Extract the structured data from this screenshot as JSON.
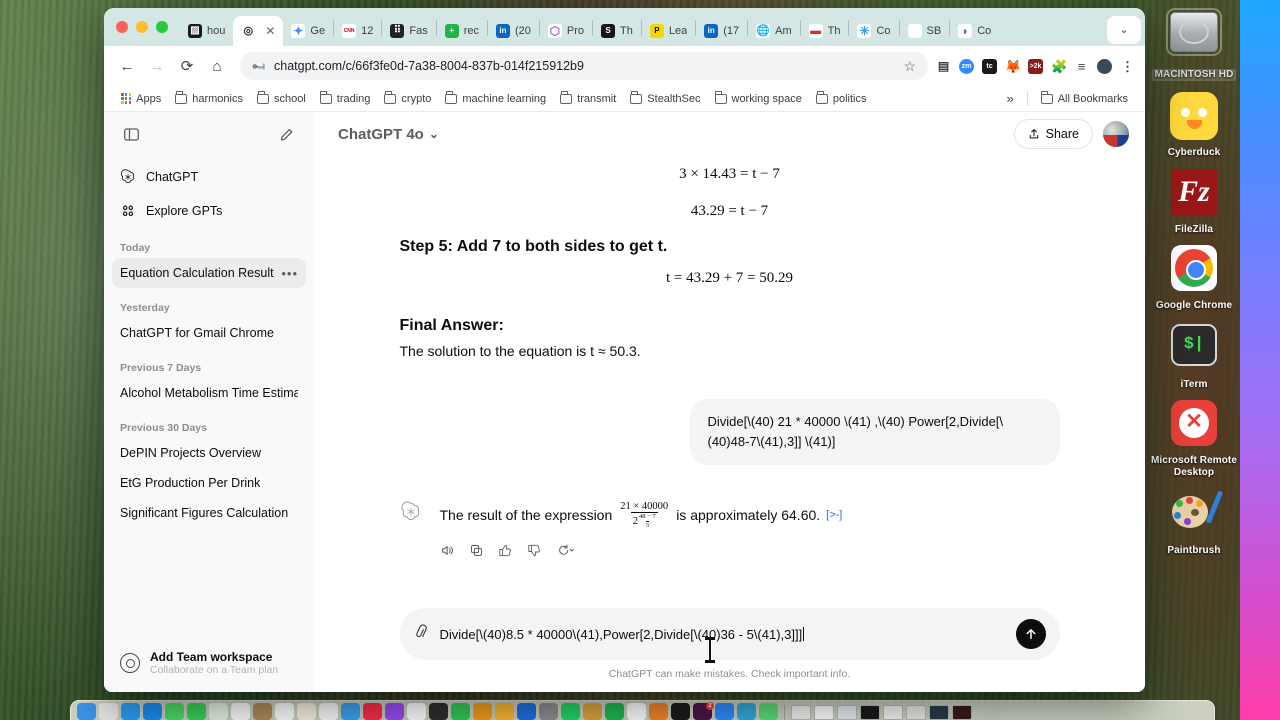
{
  "desktop": {
    "icons": [
      {
        "label": "MACINTOSH HD",
        "icon": "hard-drive-icon",
        "selected": true
      },
      {
        "label": "Cyberduck",
        "icon": "cyberduck-icon",
        "selected": false
      },
      {
        "label": "FileZilla",
        "icon": "filezilla-icon",
        "selected": false
      },
      {
        "label": "Google Chrome",
        "icon": "chrome-icon",
        "selected": false
      },
      {
        "label": "iTerm",
        "icon": "iterm-icon",
        "selected": false
      },
      {
        "label": "Microsoft Remote Desktop",
        "icon": "remote-desktop-icon",
        "selected": false
      },
      {
        "label": "Paintbrush",
        "icon": "paintbrush-icon",
        "selected": false
      }
    ]
  },
  "dock": {
    "apps": [
      {
        "name": "finder",
        "color": "#3b94e8"
      },
      {
        "name": "launchpad",
        "color": "#e8e8e8"
      },
      {
        "name": "safari",
        "color": "#2a9ef4"
      },
      {
        "name": "mail",
        "color": "#1c8ef0"
      },
      {
        "name": "messages",
        "color": "#4cd964"
      },
      {
        "name": "facetime",
        "color": "#3ccf5a"
      },
      {
        "name": "maps",
        "color": "#e6f2e3"
      },
      {
        "name": "photos",
        "color": "#fdfdfd"
      },
      {
        "name": "contacts",
        "color": "#b08a5c"
      },
      {
        "name": "calendar",
        "color": "#ffffff"
      },
      {
        "name": "notes",
        "color": "#f7f2e6"
      },
      {
        "name": "reminders",
        "color": "#fafafa"
      },
      {
        "name": "freeform",
        "color": "#3ba3f0"
      },
      {
        "name": "music",
        "color": "#fa2d48"
      },
      {
        "name": "podcasts",
        "color": "#9a4df0"
      },
      {
        "name": "tv",
        "color": "#ffffff"
      },
      {
        "name": "keynote",
        "color": "#2e2e2e"
      },
      {
        "name": "numbers",
        "color": "#35c759"
      },
      {
        "name": "pages",
        "color": "#f29c1f"
      },
      {
        "name": "preview",
        "color": "#f7b733"
      },
      {
        "name": "xcode",
        "color": "#1f6fdd"
      },
      {
        "name": "settings",
        "color": "#8e8e93"
      },
      {
        "name": "whatsapp",
        "color": "#25d366"
      },
      {
        "name": "notion",
        "color": "#d9a441"
      },
      {
        "name": "spotify",
        "color": "#1db954"
      },
      {
        "name": "chrome",
        "color": "#ffffff"
      },
      {
        "name": "thunderbird",
        "color": "#f2852a"
      },
      {
        "name": "iterm",
        "color": "#1c1c1c"
      },
      {
        "name": "slack",
        "color": "#4a154b",
        "badge": "2"
      },
      {
        "name": "zoom",
        "color": "#2d8cff"
      },
      {
        "name": "telegram",
        "color": "#34aadc"
      },
      {
        "name": "whatsapp-web",
        "color": "#5ddc7a"
      }
    ],
    "windows": 8
  },
  "browser": {
    "window_controls": [
      "close",
      "minimize",
      "maximize"
    ],
    "tabs": [
      {
        "label": "hou",
        "favicon": "dark-grid",
        "color": "#1a1a1a",
        "active": false
      },
      {
        "label": "",
        "favicon": "openai",
        "color": "#2b2b2b",
        "active": true
      },
      {
        "label": "Ge",
        "favicon": "gemini-sparkle",
        "color": "#4b8bf5",
        "active": false
      },
      {
        "label": "12",
        "favicon": "cnn",
        "color": "#cc0000",
        "active": false
      },
      {
        "label": "Fas",
        "favicon": "dice",
        "color": "#222222",
        "active": false
      },
      {
        "label": "rec",
        "favicon": "plus-green",
        "color": "#20b24b",
        "active": false
      },
      {
        "label": "(20",
        "favicon": "linkedin",
        "color": "#0a66c2",
        "active": false
      },
      {
        "label": "Pro",
        "favicon": "shield",
        "color": "#a06ad4",
        "active": false
      },
      {
        "label": "Th",
        "favicon": "s-dark",
        "color": "#151515",
        "active": false
      },
      {
        "label": "Lea",
        "favicon": "p-yellow",
        "color": "#f5d800",
        "active": false
      },
      {
        "label": "(17",
        "favicon": "linkedin",
        "color": "#0a66c2",
        "active": false
      },
      {
        "label": "Am",
        "favicon": "globe",
        "color": "#5b5b5b",
        "active": false
      },
      {
        "label": "Th",
        "favicon": "red-bar",
        "color": "#d33030",
        "active": false
      },
      {
        "label": "Co",
        "favicon": "asterisk-blue",
        "color": "#2e9bf0",
        "active": false
      },
      {
        "label": "SB",
        "favicon": "squirrel",
        "color": "#cf7a3a",
        "active": false
      },
      {
        "label": "Co",
        "favicon": "moon-purple",
        "color": "#6b57d8",
        "active": false
      }
    ],
    "new_tab_label": "+",
    "tab_list_chevron": "⌄",
    "nav": {
      "back": "←",
      "forward": "→",
      "reload": "⟳",
      "home": "⌂",
      "site_info": "site-info-icon",
      "url": "chatgpt.com/c/66f3fe0d-7a38-8004-837b-014f215912b9",
      "bookmark_star": "☆"
    },
    "extensions": [
      {
        "name": "ext-dark-tag",
        "color": "#3c4043"
      },
      {
        "name": "zoom-ext",
        "color": "#2d8cff",
        "text": "zm"
      },
      {
        "name": "tc-ext",
        "color": "#1a1a1a",
        "text": "tc"
      },
      {
        "name": "metamask-ext",
        "color": "#e2761b"
      },
      {
        "name": "toolbox-ext",
        "color": "#8a1c1c",
        "text": ">2k"
      },
      {
        "name": "puzzle-ext",
        "color": "#5f6368"
      },
      {
        "name": "reading-list-icon",
        "color": "#3c4043"
      },
      {
        "name": "profile-avatar",
        "color": "#3a4a5a"
      },
      {
        "name": "chrome-menu-icon",
        "color": "#3c4043"
      }
    ],
    "bookmarks": {
      "apps_label": "Apps",
      "items": [
        "harmonics",
        "school",
        "trading",
        "crypto",
        "machine learning",
        "transmit",
        "StealthSec",
        "working space",
        "politics"
      ],
      "overflow": "»",
      "all_bookmarks": "All Bookmarks"
    }
  },
  "chatgpt": {
    "sidebar": {
      "toggle_icon": "sidebar-toggle-icon",
      "new_chat_icon": "new-chat-icon",
      "nav": [
        {
          "label": "ChatGPT",
          "icon": "openai-logo-icon"
        },
        {
          "label": "Explore GPTs",
          "icon": "explore-gpts-icon"
        }
      ],
      "sections": [
        {
          "title": "Today",
          "chats": [
            {
              "title": "Equation Calculation Result",
              "active": true,
              "menu": "•••"
            }
          ]
        },
        {
          "title": "Yesterday",
          "chats": [
            {
              "title": "ChatGPT for Gmail Chrome",
              "active": false
            }
          ]
        },
        {
          "title": "Previous 7 Days",
          "chats": [
            {
              "title": "Alcohol Metabolism Time Estimate",
              "active": false
            }
          ]
        },
        {
          "title": "Previous 30 Days",
          "chats": [
            {
              "title": "DePIN Projects Overview",
              "active": false
            },
            {
              "title": "EtG Production Per Drink",
              "active": false
            },
            {
              "title": "Significant Figures Calculation",
              "active": false
            }
          ]
        }
      ],
      "team": {
        "title": "Add Team workspace",
        "subtitle": "Collaborate on a Team plan",
        "icon": "team-badge-icon"
      }
    },
    "header": {
      "model": "ChatGPT 4o",
      "model_chevron": "⌄",
      "share_label": "Share",
      "share_icon": "share-icon",
      "avatar": "user-avatar"
    },
    "thread": {
      "equations": [
        "3 × 14.43 = t − 7",
        "43.29 = t − 7"
      ],
      "step_heading": "Step 5: Add 7 to both sides to get t.",
      "step_equation": "t = 43.29 + 7 = 50.29",
      "final_heading": "Final Answer:",
      "final_text": "The solution to the equation is t ≈ 50.3.",
      "user_message": "Divide[\\(40) 21 * 40000 \\(41) ,\\(40)  Power[2,Divide[\\(40)48-7\\(41),3]] \\(41)]",
      "assistant": {
        "prefix": "The result of the expression",
        "fraction": {
          "numerator": "21 × 40000",
          "denominator_base": "2",
          "denominator_exp_num": "48 − 7",
          "denominator_exp_den": "3"
        },
        "suffix": "is approximately 64.60.",
        "citation": "[>-]"
      },
      "action_icons": [
        "speaker-icon",
        "copy-icon",
        "thumbs-up-icon",
        "thumbs-down-icon",
        "regenerate-icon"
      ]
    },
    "composer": {
      "attach_icon": "paperclip-icon",
      "value": "Divide[\\(40)8.5 * 40000\\(41),Power[2,Divide[\\(40)36 - 5\\(41),3]]]",
      "send_icon": "send-arrow-icon",
      "disclaimer": "ChatGPT can make mistakes. Check important info.",
      "help_label": "?"
    }
  }
}
